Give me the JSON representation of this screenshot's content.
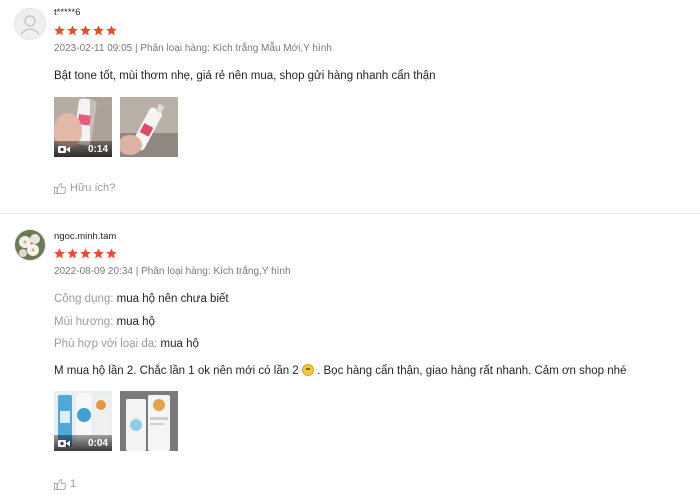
{
  "reviews": [
    {
      "username": "t*****6",
      "rating": 5,
      "date": "2023-02-11 09:05",
      "variation_label": "Phân loại hàng:",
      "variation": "Kích trắng Mẫu Mới,Y hình",
      "text": "Bật tone tốt, mùi thơm nhẹ, giá rẻ nên mua, shop gửi hàng nhanh cẩn thận",
      "media": [
        {
          "type": "video",
          "duration": "0:14"
        },
        {
          "type": "image"
        }
      ],
      "helpful_label": "Hữu ích?"
    },
    {
      "username": "ngoc.minh.tam",
      "rating": 5,
      "date": "2022-08-09 20:34",
      "variation_label": "Phân loại hàng:",
      "variation": "Kích trắng,Y hình",
      "attributes": [
        {
          "key": "Công dụng:",
          "value": "mua hộ nên chưa biết"
        },
        {
          "key": "Mùi hương:",
          "value": "mua hộ"
        },
        {
          "key": "Phù hợp với loại da:",
          "value": "mua hộ"
        }
      ],
      "text_part1": "M mua hộ lần 2. Chắc lần 1 ok nên mới có lần 2",
      "text_part2": ". Bọc hàng cẩn thận, giao hàng rất nhanh. Cảm ơn shop nhé",
      "media": [
        {
          "type": "video",
          "duration": "0:04"
        },
        {
          "type": "image"
        }
      ],
      "helpful_count": "1"
    }
  ],
  "colors": {
    "star": "#ee4d2d",
    "muted": "#8a8a8a"
  }
}
